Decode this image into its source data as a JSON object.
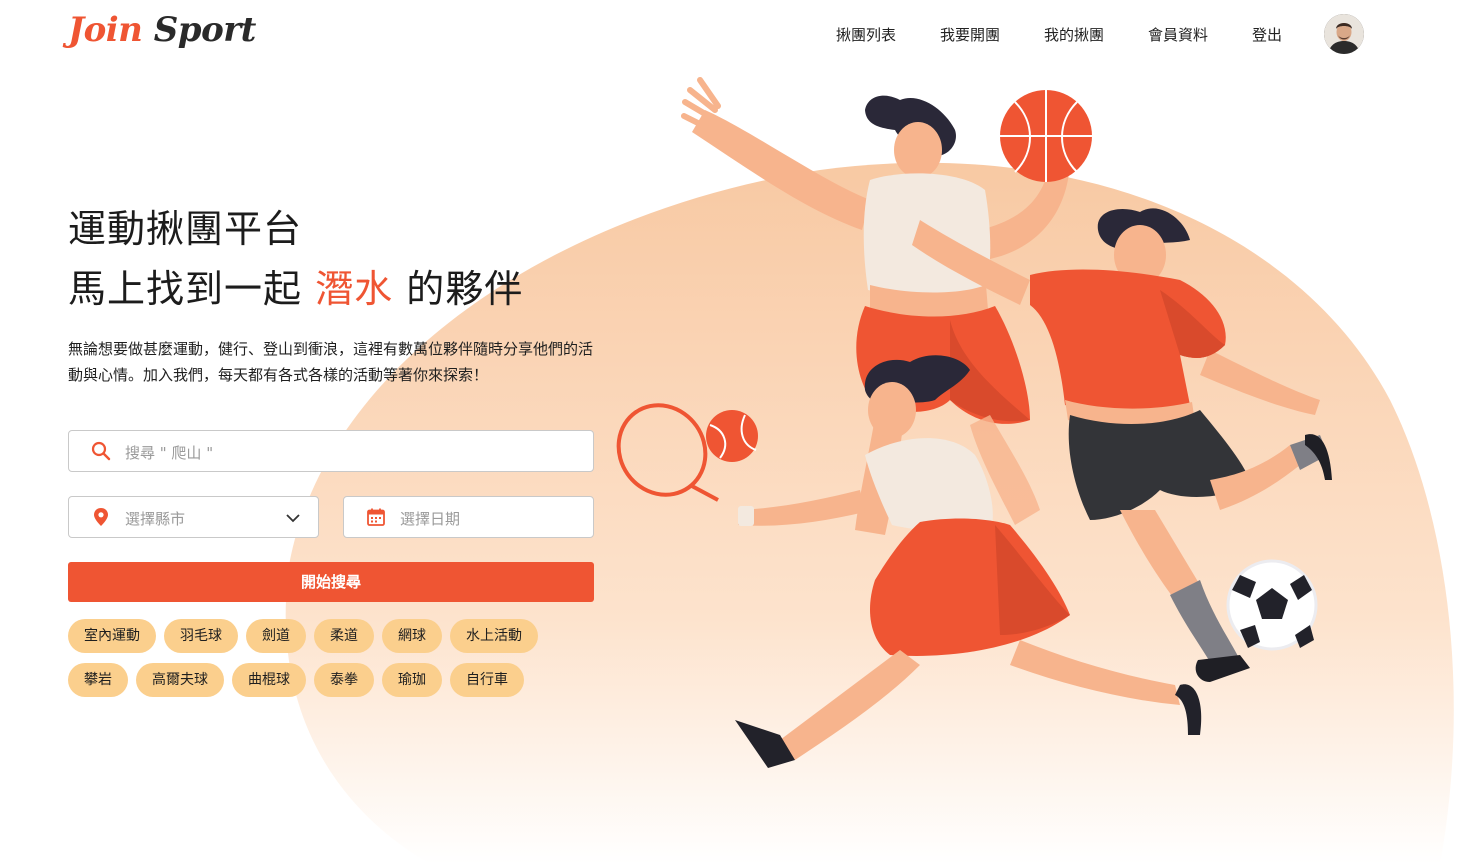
{
  "brand": {
    "logo_word1": "Join",
    "logo_word2": "Sport",
    "accent_color": "#ef5533",
    "tag_color": "#fbcf8d"
  },
  "nav": {
    "items": [
      {
        "label": "揪團列表"
      },
      {
        "label": "我要開團"
      },
      {
        "label": "我的揪團"
      },
      {
        "label": "會員資料"
      },
      {
        "label": "登出"
      }
    ],
    "avatar_icon": "user-avatar"
  },
  "hero": {
    "title_line1": "運動揪團平台",
    "title_line2_before": "馬上找到一起",
    "title_line2_accent": "潛水",
    "title_line2_after": "的夥伴",
    "description": "無論想要做甚麼運動，健行、登山到衝浪，這裡有數萬位夥伴隨時分享他們的活動與心情。加入我們，每天都有各式各樣的活動等著你來探索！"
  },
  "search": {
    "keyword_placeholder": "搜尋 \" 爬山 \"",
    "city_placeholder": "選擇縣市",
    "date_placeholder": "選擇日期",
    "submit_label": "開始搜尋",
    "icons": {
      "keyword": "search-icon",
      "city": "location-pin-icon",
      "date": "calendar-icon",
      "dropdown": "chevron-down-icon"
    }
  },
  "tags": [
    {
      "label": "室內運動"
    },
    {
      "label": "羽毛球"
    },
    {
      "label": "劍道"
    },
    {
      "label": "柔道"
    },
    {
      "label": "網球"
    },
    {
      "label": "水上活動"
    },
    {
      "label": "攀岩"
    },
    {
      "label": "高爾夫球"
    },
    {
      "label": "曲棍球"
    },
    {
      "label": "泰拳"
    },
    {
      "label": "瑜珈"
    },
    {
      "label": "自行車"
    }
  ]
}
